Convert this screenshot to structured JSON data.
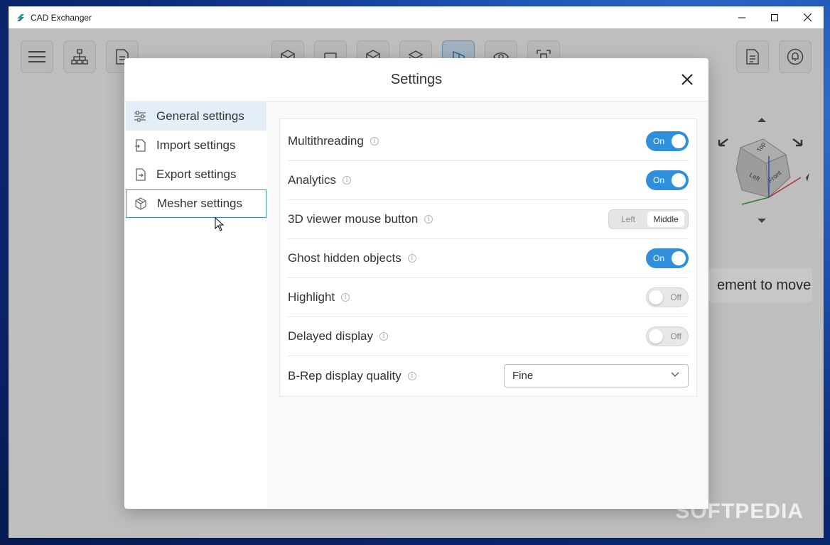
{
  "window": {
    "title": "CAD Exchanger"
  },
  "background_hint": "ement to move",
  "watermark": "SOFTPEDIA",
  "viewcube": {
    "faces": [
      "Top",
      "Left",
      "Front"
    ]
  },
  "dialog": {
    "title": "Settings",
    "nav": [
      {
        "label": "General settings",
        "icon": "sliders-icon",
        "selected": true
      },
      {
        "label": "Import settings",
        "icon": "import-file-icon",
        "selected": false
      },
      {
        "label": "Export settings",
        "icon": "export-file-icon",
        "selected": false
      },
      {
        "label": "Mesher settings",
        "icon": "mesh-cube-icon",
        "selected": false
      }
    ],
    "settings": [
      {
        "label": "Multithreading",
        "control": "toggle",
        "value": "On"
      },
      {
        "label": "Analytics",
        "control": "toggle",
        "value": "On"
      },
      {
        "label": "3D viewer mouse button",
        "control": "segment",
        "options": [
          "Left",
          "Middle"
        ],
        "value": "Middle"
      },
      {
        "label": "Ghost hidden objects",
        "control": "toggle",
        "value": "On"
      },
      {
        "label": "Highlight",
        "control": "toggle",
        "value": "Off"
      },
      {
        "label": "Delayed display",
        "control": "toggle",
        "value": "Off"
      },
      {
        "label": "B-Rep display quality",
        "control": "select",
        "value": "Fine"
      }
    ]
  },
  "colors": {
    "accent": "#2f8fdb",
    "nav_selected_bg": "#e3eef8",
    "toggle_off_bg": "#e8e8e8"
  }
}
